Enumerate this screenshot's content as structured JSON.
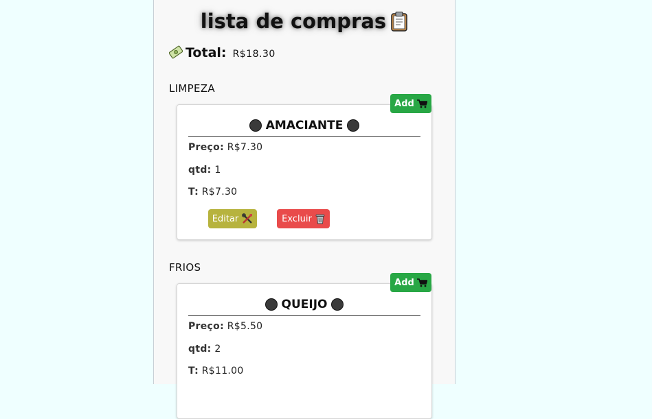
{
  "header": {
    "title": "lista de compras"
  },
  "summary": {
    "total_label": "Total:",
    "total_value": "R$18.30"
  },
  "labels": {
    "add": "Add",
    "edit": "Editar",
    "delete": "Excluir",
    "price": "Preço:",
    "qty": "qtd:",
    "subtotal": "T:"
  },
  "categories": [
    {
      "name": "LIMPEZA",
      "item": {
        "name": "AMACIANTE",
        "price": "R$7.30",
        "qty": "1",
        "subtotal": "R$7.30"
      }
    },
    {
      "name": "FRIOS",
      "item": {
        "name": "QUEIJO",
        "price": "R$5.50",
        "qty": "2",
        "subtotal": "R$11.00"
      }
    }
  ],
  "colors": {
    "page_bg": "#efffff",
    "add_button": "#28a745",
    "edit_button": "#b7b33e",
    "delete_button": "#e94b4b"
  },
  "icons": [
    "clipboard-icon",
    "money-icon",
    "cart-icon",
    "tools-icon",
    "trash-icon",
    "black-circle-icon"
  ]
}
